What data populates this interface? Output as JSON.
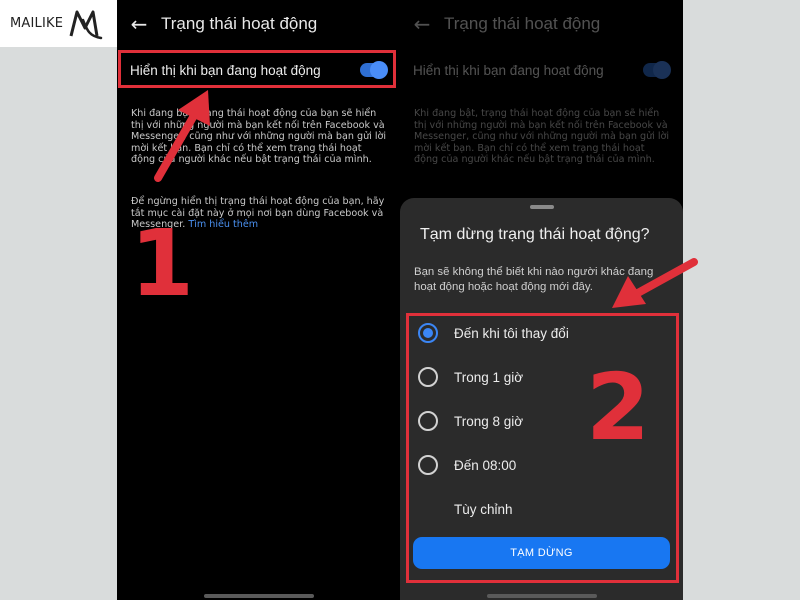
{
  "logo": {
    "text": "MAILIKE"
  },
  "left_screen": {
    "title": "Trạng thái hoạt động",
    "toggle_label": "Hiển thị khi bạn đang hoạt động",
    "para1": "Khi đang bật, trạng thái hoạt động của bạn sẽ hiển thị với những người mà bạn kết nối trên Facebook và Messenger, cũng như với những người mà bạn gửi lời mời kết bạn. Bạn chỉ có thể xem trạng thái hoạt động của người khác nếu bật trạng thái của mình.",
    "para2": "Để ngừng hiển thị trạng thái hoạt động của bạn, hãy tắt mục cài đặt này ở mọi nơi bạn dùng Facebook và Messenger.",
    "learn_more": "Tìm hiểu thêm"
  },
  "right_screen": {
    "title": "Trạng thái hoạt động",
    "toggle_label": "Hiển thị khi bạn đang hoạt động",
    "para1": "Khi đang bật, trạng thái hoạt động của bạn sẽ hiển thị với những người mà bạn kết nối trên Facebook và Messenger, cũng như với những người mà bạn gửi lời mời kết bạn. Bạn chỉ có thể xem trạng thái hoạt động của người khác nếu bật trạng thái của mình."
  },
  "sheet": {
    "title": "Tạm dừng trạng thái hoạt động?",
    "description": "Bạn sẽ không thể biết khi nào người khác đang hoạt động hoặc hoạt động mới đây.",
    "options": [
      {
        "label": "Đến khi tôi thay đổi",
        "selected": true
      },
      {
        "label": "Trong 1 giờ",
        "selected": false
      },
      {
        "label": "Trong 8 giờ",
        "selected": false
      },
      {
        "label": "Đến 08:00",
        "selected": false
      },
      {
        "label": "Tùy chỉnh",
        "selected": false
      }
    ],
    "confirm_button": "TẠM DỪNG"
  },
  "annotations": {
    "step1": "1",
    "step2": "2"
  },
  "colors": {
    "accent": "#1877f2",
    "annotation_red": "#e0303a",
    "background": "#000000",
    "sheet": "#2b2b2b"
  }
}
